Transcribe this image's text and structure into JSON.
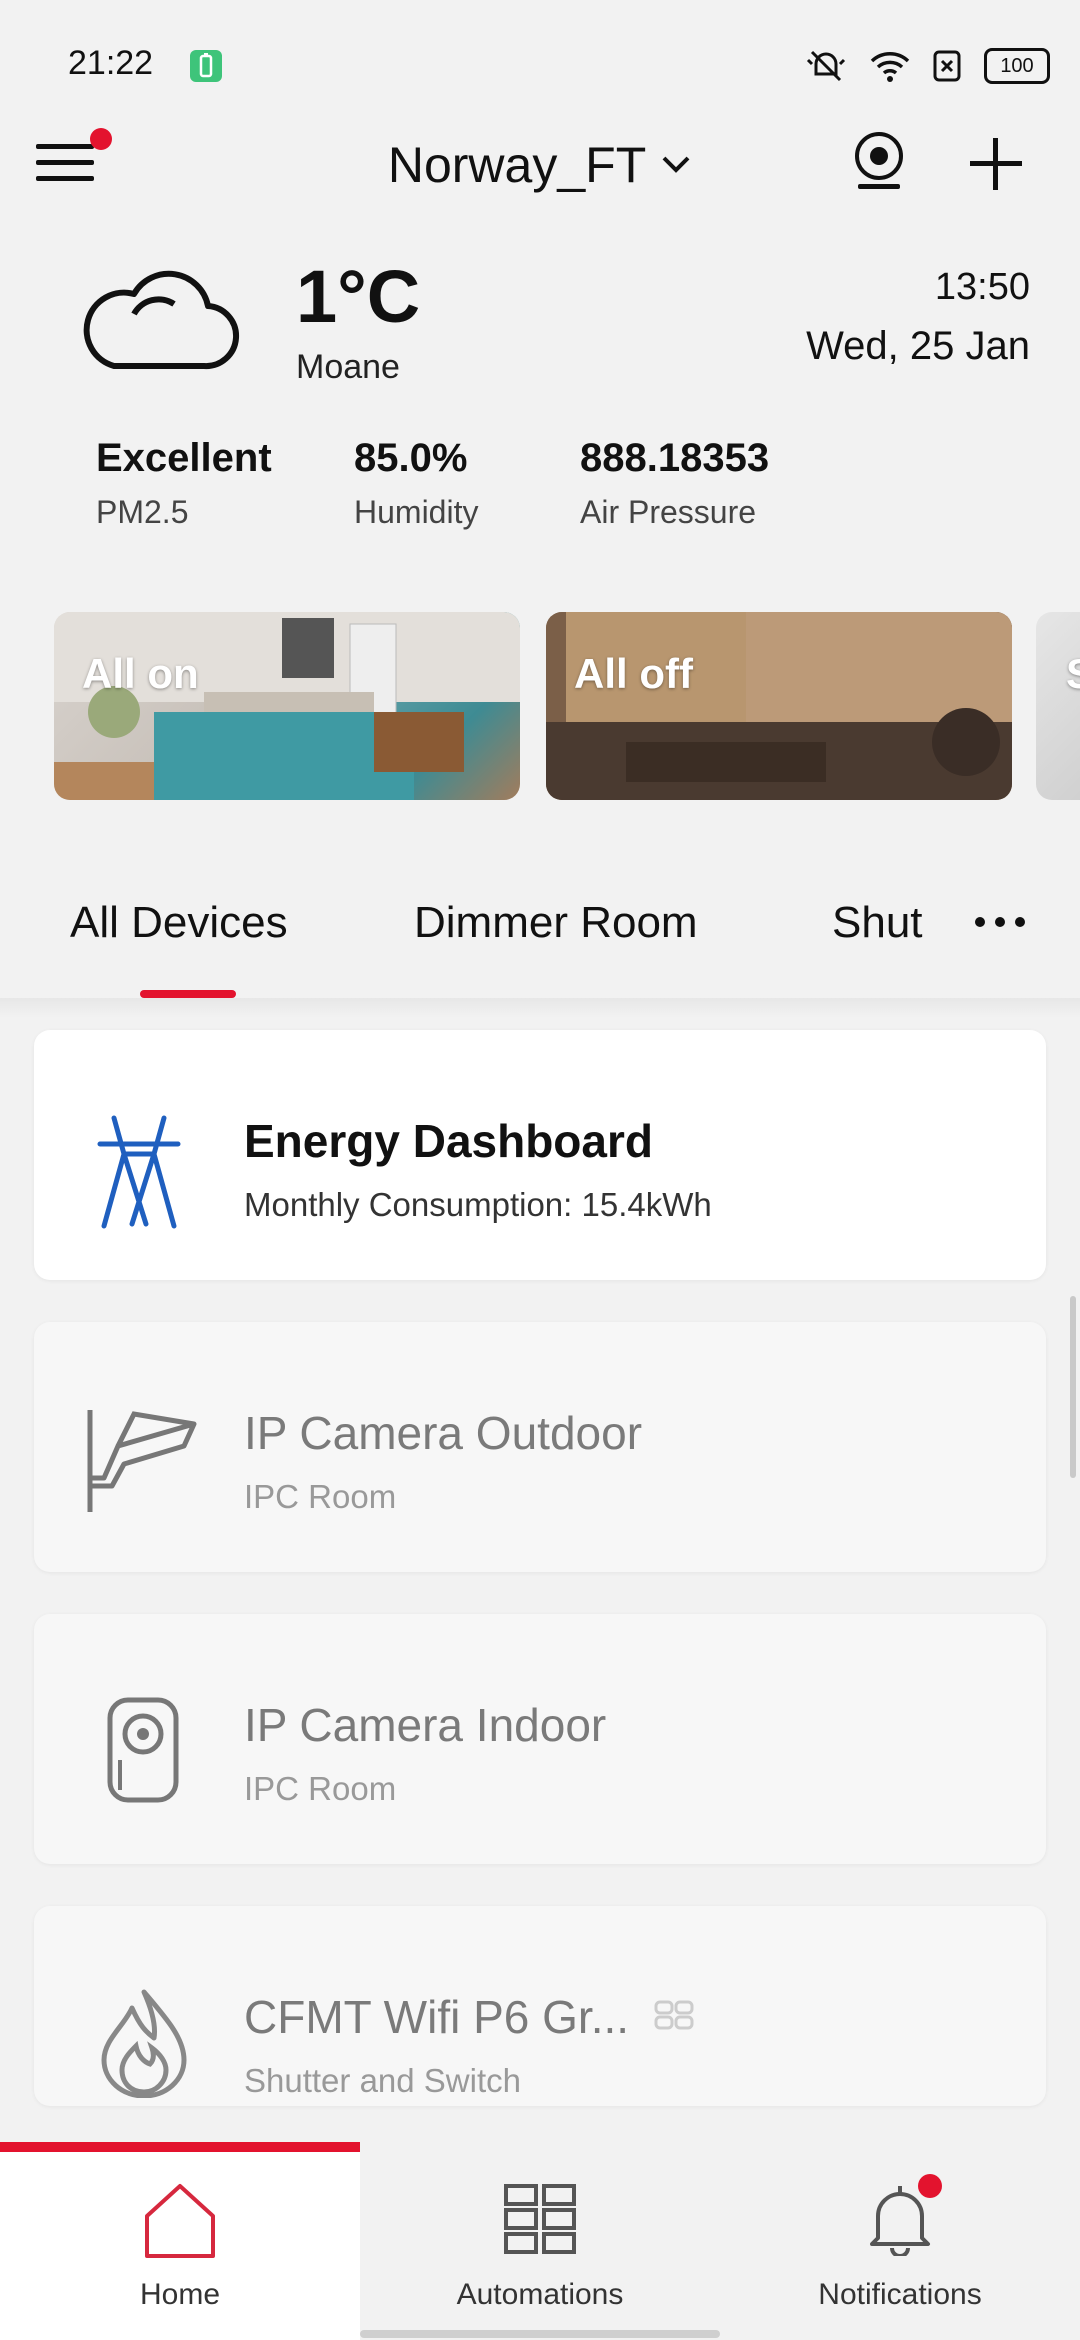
{
  "status_bar": {
    "time": "21:22",
    "battery": "100"
  },
  "header": {
    "home_name": "Norway_FT"
  },
  "weather": {
    "temperature": "1°C",
    "location": "Moane",
    "time": "13:50",
    "date": "Wed, 25 Jan",
    "metrics": [
      {
        "value": "Excellent",
        "label": "PM2.5"
      },
      {
        "value": "85.0%",
        "label": "Humidity"
      },
      {
        "value": "888.18353",
        "label": "Air Pressure"
      }
    ]
  },
  "scenes": [
    {
      "label": "All on"
    },
    {
      "label": "All off"
    },
    {
      "label": "S"
    }
  ],
  "tabs": [
    {
      "label": "All Devices",
      "active": true
    },
    {
      "label": "Dimmer Room"
    },
    {
      "label": "Shut"
    }
  ],
  "devices": [
    {
      "title": "Energy Dashboard",
      "subtitle": "Monthly Consumption: 15.4kWh",
      "icon": "energy-tower-icon"
    },
    {
      "title": "IP Camera Outdoor",
      "subtitle": "IPC Room",
      "icon": "outdoor-camera-icon"
    },
    {
      "title": "IP Camera Indoor",
      "subtitle": "IPC Room",
      "icon": "indoor-camera-icon"
    },
    {
      "title": "CFMT Wifi P6 Gr...",
      "subtitle": "Shutter and Switch",
      "icon": "flame-icon"
    }
  ],
  "bottom_nav": [
    {
      "label": "Home",
      "active": true
    },
    {
      "label": "Automations"
    },
    {
      "label": "Notifications"
    }
  ],
  "colors": {
    "accent": "#e3132e",
    "energy_icon": "#1f5fbf"
  }
}
